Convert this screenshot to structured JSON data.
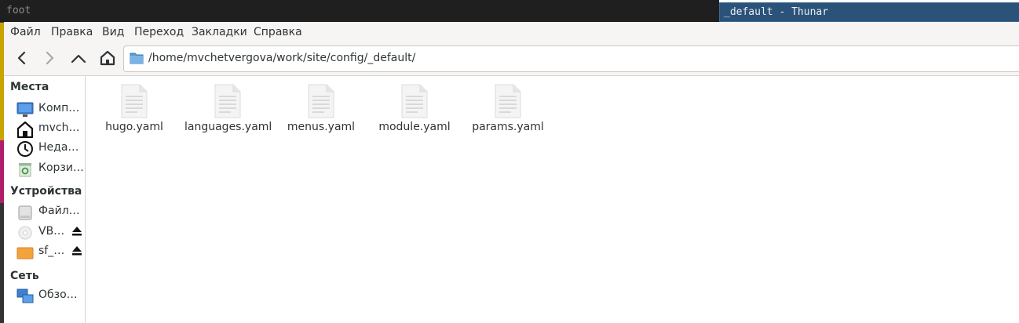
{
  "top_bar": {
    "left_title": "foot",
    "right_title": "_default - Thunar"
  },
  "menubar": {
    "items": [
      "Файл",
      "Правка",
      "Вид",
      "Переход",
      "Закладки",
      "Справка"
    ]
  },
  "toolbar": {
    "path": "/home/mvchetvergova/work/site/config/_default/"
  },
  "sidebar": {
    "places_header": "Места",
    "places": [
      {
        "label": "Комп…",
        "icon": "computer-icon"
      },
      {
        "label": "mvch…",
        "icon": "home-icon"
      },
      {
        "label": "Неда…",
        "icon": "recent-clock-icon"
      },
      {
        "label": "Корзи…",
        "icon": "trash-icon"
      }
    ],
    "devices_header": "Устройства",
    "devices": [
      {
        "label": "Файл…",
        "icon": "drive-icon",
        "eject": false
      },
      {
        "label": "VB…",
        "icon": "optical-disc-icon",
        "eject": true
      },
      {
        "label": "sf_…",
        "icon": "shared-folder-drive-icon",
        "eject": true
      }
    ],
    "network_header": "Сеть",
    "network": [
      {
        "label": "Обзо…",
        "icon": "network-icon"
      }
    ]
  },
  "files": [
    {
      "name": "hugo.yaml"
    },
    {
      "name": "languages.yaml"
    },
    {
      "name": "menus.yaml"
    },
    {
      "name": "module.yaml"
    },
    {
      "name": "params.yaml"
    }
  ]
}
